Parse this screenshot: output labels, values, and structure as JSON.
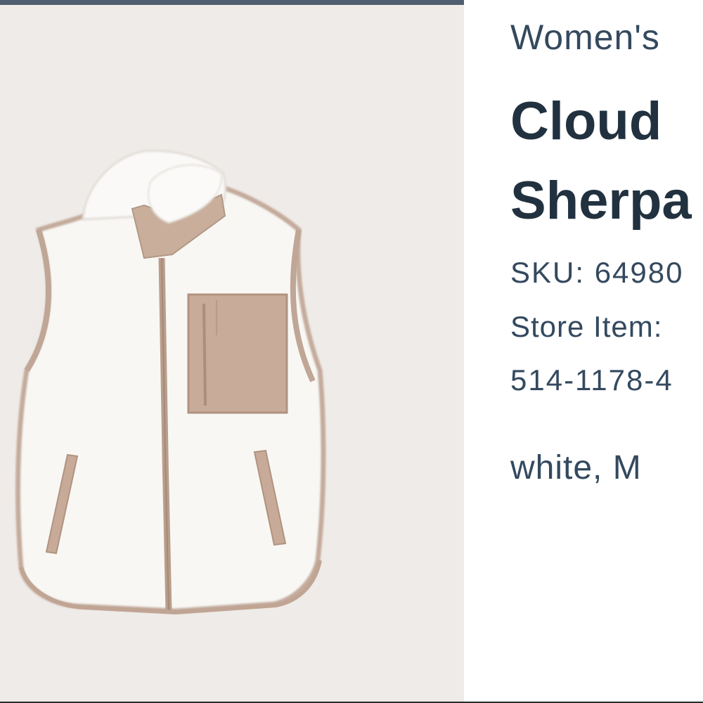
{
  "product": {
    "department": "Women's",
    "title": "Cloud Sherpa",
    "sku_label": "SKU: 64980",
    "store_item_label": "Store Item:",
    "store_item_value": "514-1178-4",
    "variant": "white, M",
    "image_icon": "sherpa-vest-image"
  },
  "colors": {
    "header_bar": "#4f5f6f",
    "text": "#2c3e50",
    "image_background": "#efebe8",
    "fleece": "#f7f6f3",
    "trim": "#bfa696"
  }
}
